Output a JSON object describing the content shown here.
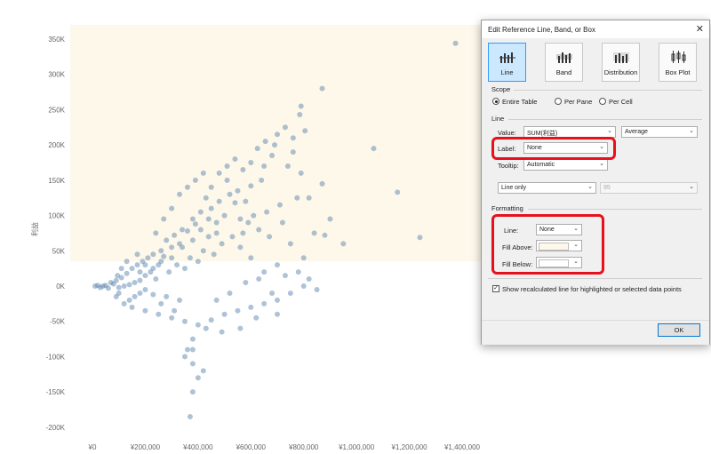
{
  "chart_data": {
    "type": "scatter",
    "ylabel": "利益",
    "xlim": [
      0,
      1400000
    ],
    "ylim": [
      -200000,
      350000
    ],
    "x_ticks": [
      "¥0",
      "¥200,000",
      "¥400,000",
      "¥600,000",
      "¥800,000",
      "¥1,000,000",
      "¥1,200,000",
      "¥1,400,000"
    ],
    "y_ticks": [
      "350K",
      "300K",
      "250K",
      "200K",
      "150K",
      "100K",
      "50K",
      "0K",
      "-50K",
      "-100K",
      "-150K",
      "-200K"
    ],
    "band_range": [
      35000,
      370000
    ],
    "band_color": "#fdf8ea",
    "point_color": "#4e79a7",
    "points": [
      [
        1375000,
        344000
      ],
      [
        870000,
        280000
      ],
      [
        1065000,
        195000
      ],
      [
        1155000,
        133000
      ],
      [
        1240000,
        69000
      ],
      [
        790000,
        255000
      ],
      [
        785000,
        243000
      ],
      [
        805000,
        220000
      ],
      [
        870000,
        145000
      ],
      [
        880000,
        72000
      ],
      [
        820000,
        125000
      ],
      [
        760000,
        190000
      ],
      [
        700000,
        215000
      ],
      [
        740000,
        170000
      ],
      [
        790000,
        160000
      ],
      [
        775000,
        125000
      ],
      [
        680000,
        185000
      ],
      [
        650000,
        170000
      ],
      [
        640000,
        150000
      ],
      [
        710000,
        115000
      ],
      [
        660000,
        105000
      ],
      [
        600000,
        142000
      ],
      [
        540000,
        118000
      ],
      [
        510000,
        150000
      ],
      [
        560000,
        95000
      ],
      [
        500000,
        100000
      ],
      [
        470000,
        90000
      ],
      [
        430000,
        125000
      ],
      [
        440000,
        70000
      ],
      [
        390000,
        88000
      ],
      [
        360000,
        78000
      ],
      [
        330000,
        60000
      ],
      [
        300000,
        55000
      ],
      [
        270000,
        42000
      ],
      [
        250000,
        30000
      ],
      [
        220000,
        20000
      ],
      [
        200000,
        15000
      ],
      [
        180000,
        8000
      ],
      [
        160000,
        5000
      ],
      [
        140000,
        2000
      ],
      [
        120000,
        0
      ],
      [
        100000,
        -2000
      ],
      [
        80000,
        3000
      ],
      [
        60000,
        -3000
      ],
      [
        50000,
        1000
      ],
      [
        40000,
        0
      ],
      [
        30000,
        -2000
      ],
      [
        20000,
        1000
      ],
      [
        10000,
        0
      ],
      [
        70000,
        5000
      ],
      [
        90000,
        8000
      ],
      [
        110000,
        12000
      ],
      [
        130000,
        18000
      ],
      [
        150000,
        25000
      ],
      [
        170000,
        30000
      ],
      [
        190000,
        35000
      ],
      [
        210000,
        40000
      ],
      [
        230000,
        45000
      ],
      [
        260000,
        50000
      ],
      [
        280000,
        65000
      ],
      [
        310000,
        72000
      ],
      [
        340000,
        80000
      ],
      [
        380000,
        95000
      ],
      [
        410000,
        105000
      ],
      [
        450000,
        110000
      ],
      [
        480000,
        120000
      ],
      [
        520000,
        130000
      ],
      [
        550000,
        135000
      ],
      [
        580000,
        120000
      ],
      [
        610000,
        100000
      ],
      [
        630000,
        80000
      ],
      [
        670000,
        70000
      ],
      [
        720000,
        90000
      ],
      [
        750000,
        60000
      ],
      [
        800000,
        40000
      ],
      [
        840000,
        75000
      ],
      [
        900000,
        95000
      ],
      [
        950000,
        60000
      ],
      [
        700000,
        30000
      ],
      [
        650000,
        20000
      ],
      [
        600000,
        40000
      ],
      [
        560000,
        55000
      ],
      [
        530000,
        70000
      ],
      [
        490000,
        60000
      ],
      [
        460000,
        45000
      ],
      [
        420000,
        50000
      ],
      [
        400000,
        35000
      ],
      [
        370000,
        40000
      ],
      [
        350000,
        25000
      ],
      [
        320000,
        30000
      ],
      [
        290000,
        20000
      ],
      [
        240000,
        10000
      ],
      [
        200000,
        -5000
      ],
      [
        180000,
        -10000
      ],
      [
        160000,
        -15000
      ],
      [
        140000,
        -20000
      ],
      [
        120000,
        -25000
      ],
      [
        100000,
        -10000
      ],
      [
        90000,
        -15000
      ],
      [
        150000,
        -30000
      ],
      [
        200000,
        -35000
      ],
      [
        250000,
        -40000
      ],
      [
        300000,
        -45000
      ],
      [
        350000,
        -50000
      ],
      [
        400000,
        -55000
      ],
      [
        450000,
        -48000
      ],
      [
        500000,
        -40000
      ],
      [
        550000,
        -35000
      ],
      [
        600000,
        -30000
      ],
      [
        650000,
        -25000
      ],
      [
        700000,
        -20000
      ],
      [
        750000,
        -10000
      ],
      [
        800000,
        0
      ],
      [
        850000,
        -5000
      ],
      [
        700000,
        -40000
      ],
      [
        620000,
        -45000
      ],
      [
        560000,
        -60000
      ],
      [
        490000,
        -65000
      ],
      [
        430000,
        -60000
      ],
      [
        380000,
        -75000
      ],
      [
        360000,
        -90000
      ],
      [
        380000,
        -90000
      ],
      [
        350000,
        -100000
      ],
      [
        380000,
        -110000
      ],
      [
        400000,
        -130000
      ],
      [
        420000,
        -120000
      ],
      [
        380000,
        -150000
      ],
      [
        370000,
        -185000
      ],
      [
        330000,
        -20000
      ],
      [
        280000,
        -15000
      ],
      [
        230000,
        -12000
      ],
      [
        260000,
        -25000
      ],
      [
        310000,
        -35000
      ],
      [
        470000,
        -20000
      ],
      [
        520000,
        -10000
      ],
      [
        580000,
        5000
      ],
      [
        630000,
        10000
      ],
      [
        680000,
        -10000
      ],
      [
        730000,
        15000
      ],
      [
        780000,
        20000
      ],
      [
        820000,
        10000
      ],
      [
        170000,
        45000
      ],
      [
        130000,
        35000
      ],
      [
        110000,
        25000
      ],
      [
        95000,
        15000
      ],
      [
        240000,
        75000
      ],
      [
        270000,
        95000
      ],
      [
        300000,
        110000
      ],
      [
        330000,
        130000
      ],
      [
        360000,
        140000
      ],
      [
        390000,
        150000
      ],
      [
        420000,
        160000
      ],
      [
        450000,
        140000
      ],
      [
        480000,
        160000
      ],
      [
        510000,
        170000
      ],
      [
        540000,
        180000
      ],
      [
        570000,
        165000
      ],
      [
        600000,
        175000
      ],
      [
        625000,
        195000
      ],
      [
        655000,
        205000
      ],
      [
        690000,
        200000
      ],
      [
        730000,
        225000
      ],
      [
        760000,
        210000
      ],
      [
        590000,
        90000
      ],
      [
        570000,
        75000
      ],
      [
        470000,
        75000
      ],
      [
        440000,
        95000
      ],
      [
        410000,
        80000
      ],
      [
        380000,
        65000
      ],
      [
        340000,
        55000
      ],
      [
        300000,
        40000
      ],
      [
        260000,
        35000
      ],
      [
        230000,
        25000
      ],
      [
        200000,
        30000
      ],
      [
        180000,
        20000
      ]
    ]
  },
  "dialog": {
    "title": "Edit Reference Line, Band, or Box",
    "close_glyph": "✕",
    "type_buttons": [
      {
        "label": "Line",
        "selected": true
      },
      {
        "label": "Band",
        "selected": false
      },
      {
        "label": "Distribution",
        "selected": false
      },
      {
        "label": "Box Plot",
        "selected": false
      }
    ],
    "scope": {
      "heading": "Scope",
      "options": [
        "Entire Table",
        "Per Pane",
        "Per Cell"
      ],
      "selected": "Entire Table"
    },
    "line": {
      "heading": "Line",
      "value_label": "Value:",
      "value": "SUM(利益)",
      "aggregation": "Average",
      "label_label": "Label:",
      "label_value": "None",
      "tooltip_label": "Tooltip:",
      "tooltip_value": "Automatic",
      "ci_mode": "Line only",
      "ci_value": "95"
    },
    "formatting": {
      "heading": "Formatting",
      "line_label": "Line:",
      "line_value": "None",
      "fill_above_label": "Fill Above:",
      "fill_above_color": "#fdf8ea",
      "fill_below_label": "Fill Below:",
      "fill_below_color": "#ffffff"
    },
    "recalc_checked": true,
    "recalc_label": "Show recalculated line for highlighted or selected data points",
    "ok_label": "OK"
  }
}
